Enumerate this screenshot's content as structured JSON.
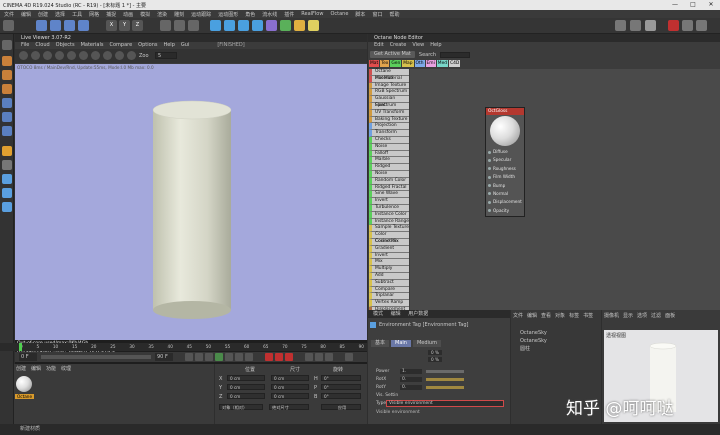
{
  "app_title": "CINEMA 4D R19.024 Studio (RC - R19) - [未标题 1 *] - 主要",
  "window_controls": [
    "—",
    "□",
    "✕"
  ],
  "menubar": [
    "文件",
    "编辑",
    "创建",
    "选择",
    "工具",
    "网格",
    "捕捉",
    "动画",
    "模拟",
    "渲染",
    "雕刻",
    "运动跟踪",
    "运动图形",
    "角色",
    "流水线",
    "插件",
    "RealFlow",
    "Octane",
    "脚本",
    "窗口",
    "帮助"
  ],
  "live_viewer": {
    "title": "Live Viewer 3.07-R2",
    "menu": [
      "File",
      "Cloud",
      "Objects",
      "Materials",
      "Compare",
      "Options",
      "Help",
      "Gui"
    ],
    "zoom_label": "Zoo",
    "zoom_value": "5",
    "status_label": "[FINISHED]",
    "viewport_info": "OTOCO 8ms / MainDev/Rnd, Update:55ms, Mode:I.0 Mb max: 0.0"
  },
  "status_lines": [
    "Out-of-core used/max:0Kb/4Gb",
    "Grey8/16: 0/0          Rgb32/64: 0/1",
    "Used/free/total vram: 390Mb/1.161Gb/2Gb",
    "Rendering: 100%    Ms/sec: 0    Time: 00 : 00 : 01/00 : 00 : 01    Spp/maxspp: 128/128    Tri: 0/9k4    Mesh: 1    Hair: 0    GPU: 0    33°C"
  ],
  "octane_editor": {
    "title": "Octane Node Editor",
    "menu": [
      "Edit",
      "Create",
      "View",
      "Help"
    ],
    "toolbar": [
      "Get Active Mat",
      "Search"
    ],
    "tabs": [
      "Mat",
      "Tex",
      "Gen",
      "Map",
      "Oth",
      "Emi",
      "Med",
      "C4D"
    ],
    "tab_colors": [
      "#e04d4d",
      "#e0a34d",
      "#5bcf5b",
      "#d7c14d",
      "#7da9e8",
      "#e8a0e0",
      "#78d6c9",
      "#cfcfcf"
    ],
    "node_list": [
      "Octane Material",
      "Mix Material",
      "Image Texture",
      "RGB Spectrum",
      "Gaussian Spectrum",
      "Float",
      "UV Transform",
      "Baking Texture",
      "Projection",
      "Transform",
      "Checks",
      "Noise",
      "Falloff",
      "Marble",
      "Ridged",
      "Noise",
      "Random Color",
      "Ridged Fractal",
      "Sine Wave",
      "Invert",
      "Turbulence",
      "Instance Color",
      "Instance Range",
      "Sample Texture",
      "Color Correction",
      "Cosine Mix",
      "Gradient",
      "Invert",
      "Mix",
      "Multiply",
      "Add",
      "Subtract",
      "Compare",
      "Triplanar",
      "Vertex Ramp",
      "Displacement",
      "Cinema Texture"
    ],
    "node": {
      "title": "OctGloss",
      "pins": [
        "Diffuse",
        "Specular",
        "Roughness",
        "Film Width",
        "Bump",
        "Normal",
        "Displacement",
        "Opacity"
      ]
    }
  },
  "timeline": {
    "ticks": [
      "0",
      "5",
      "10",
      "15",
      "20",
      "25",
      "30",
      "35",
      "40",
      "45",
      "50",
      "55",
      "60",
      "65",
      "70",
      "75",
      "80",
      "85",
      "90"
    ],
    "current_frame": "0 F",
    "end_frame": "90 F"
  },
  "material_panel": {
    "menu": [
      "创建",
      "编辑",
      "功能",
      "纹理"
    ],
    "material_label": "Octane"
  },
  "coords_panel": {
    "headers": [
      "位置",
      "尺寸",
      "旋转"
    ],
    "rows": [
      {
        "axis": "X",
        "pos": "0 cm",
        "size": "0 cm",
        "rot_label": "H",
        "rot": "0°"
      },
      {
        "axis": "Y",
        "pos": "0 cm",
        "size": "0 cm",
        "rot_label": "P",
        "rot": "0°"
      },
      {
        "axis": "Z",
        "pos": "0 cm",
        "size": "0 cm",
        "rot_label": "B",
        "rot": "0°"
      }
    ],
    "mode": "对象（相对）",
    "size_mode": "绝对尺寸",
    "apply": "应用"
  },
  "attributes": {
    "header_menu": [
      "模式",
      "编辑",
      "用户数据"
    ],
    "tag_title": "Environment Tag [Environment Tag]",
    "tabs": [
      "基本",
      "Main",
      "Medium"
    ],
    "active_tab": "Main",
    "rows": [
      {
        "label": "Power",
        "value": "1."
      },
      {
        "label": "RotX",
        "value": "0."
      },
      {
        "label": "RotY",
        "value": "0."
      },
      {
        "label": "Vis. Settin"
      },
      {
        "label": "Type",
        "value": "Visible environment"
      },
      {
        "label": "Visible environment"
      }
    ],
    "right_cols": [
      "0 %",
      "0 %"
    ]
  },
  "objects": {
    "menu": [
      "文件",
      "编辑",
      "查看",
      "对象",
      "标签",
      "书签"
    ],
    "items": [
      "OctaneSky",
      "OctaneSky",
      "圆柱"
    ]
  },
  "right_viewport": {
    "menu": [
      "摄像机",
      "显示",
      "选项",
      "过滤",
      "面板"
    ],
    "label": "透视视图"
  },
  "bottom_hint": "新建材质",
  "watermark": "知乎 @呵呵哒",
  "colors": {
    "viewport_bg": "#a4a8dc",
    "node_header": "#b4382f",
    "highlight": "#d04a4a"
  }
}
